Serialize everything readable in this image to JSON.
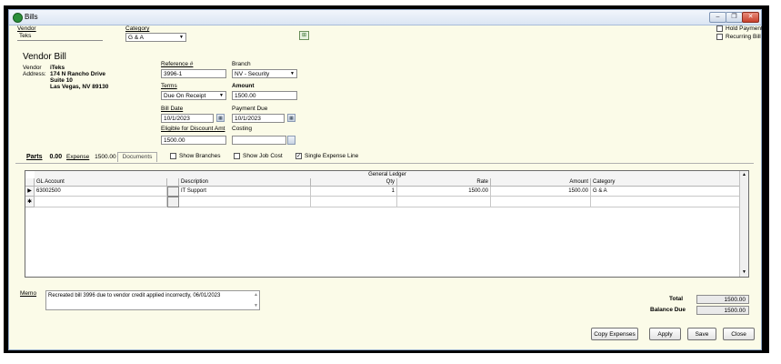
{
  "window": {
    "title": "Bills"
  },
  "top": {
    "vendor_label": "Vendor",
    "vendor_value": "Teks",
    "category_label": "Category",
    "category_value": "G & A",
    "hold_payment_label": "Hold Payment",
    "recurring_bill_label": "Recurring Bill"
  },
  "header": {
    "title": "Vendor Bill",
    "vendor_label": "Vendor",
    "address_label": "Address:",
    "vendor_name": "iTeks",
    "address_line1": "174 N Rancho Drive",
    "address_line2": "Suite 10",
    "address_line3": "Las Vegas, NV  89130"
  },
  "fields": {
    "reference_label": "Reference #",
    "reference_value": "3996-1",
    "branch_label": "Branch",
    "branch_value": "NV - Security",
    "terms_label": "Terms",
    "terms_value": "Due On Receipt",
    "amount_label": "Amount",
    "amount_value": "1500.00",
    "bill_date_label": "Bill Date",
    "bill_date_value": "10/1/2023",
    "payment_due_label": "Payment Due",
    "payment_due_value": "10/1/2023",
    "eligible_label": "Eligible for Discount Amt",
    "eligible_value": "1500.00",
    "costing_label": "Costing",
    "costing_value": ""
  },
  "tabs": {
    "parts_label": "Parts",
    "parts_value": "0.00",
    "expense_label": "Expense",
    "expense_value": "1500.00",
    "documents_label": "Documents"
  },
  "options": {
    "show_branches": "Show Branches",
    "show_job_cost": "Show Job Cost",
    "single_expense_line": "Single Expense Line"
  },
  "grid": {
    "group_title": "General Ledger",
    "columns": [
      "GL Account",
      "Description",
      "Qty",
      "Rate",
      "Amount",
      "Category"
    ],
    "rows": [
      {
        "gl_account": "63002500",
        "description": "IT Support",
        "qty": "1",
        "rate": "1500.00",
        "amount": "1500.00",
        "category": "G & A"
      }
    ]
  },
  "memo": {
    "label": "Memo",
    "value": "Recreated bill 3996 due to vendor credit applied incorrectly, 06/01/2023"
  },
  "totals": {
    "total_label": "Total",
    "total_value": "1500.00",
    "balance_label": "Balance Due",
    "balance_value": "1500.00"
  },
  "buttons": {
    "copy_expenses": "Copy Expenses",
    "apply": "Apply",
    "save": "Save",
    "close": "Close"
  }
}
